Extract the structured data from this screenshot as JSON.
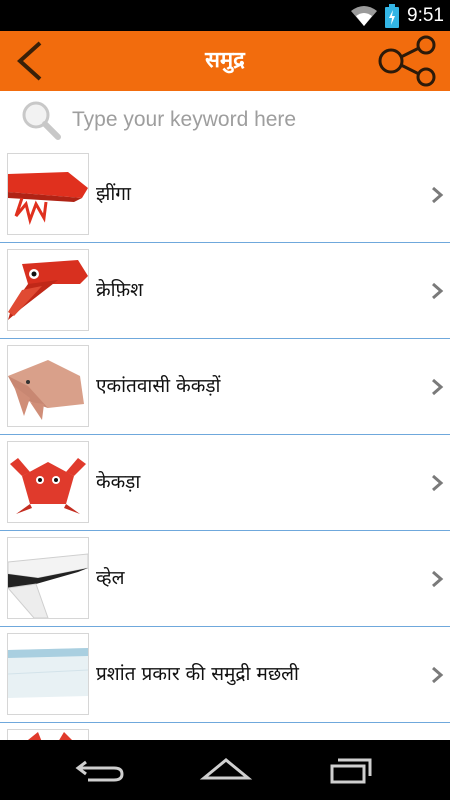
{
  "status": {
    "time": "9:51"
  },
  "header": {
    "title": "समुद्र"
  },
  "search": {
    "placeholder": "Type your keyword here"
  },
  "items": [
    {
      "label": "झींगा"
    },
    {
      "label": "क्रेफ़िश"
    },
    {
      "label": "एकांतवासी केकड़ों"
    },
    {
      "label": "केकड़ा"
    },
    {
      "label": "व्हेल"
    },
    {
      "label": "प्रशांत प्रकार की समुद्री मछली"
    }
  ],
  "colors": {
    "appbar": "#f26c0d",
    "divider": "#6fa8dc"
  },
  "icons": {
    "back": "back-arrow-icon",
    "share": "share-icon",
    "search": "magnifier-icon",
    "chevron": "chevron-right-icon"
  }
}
